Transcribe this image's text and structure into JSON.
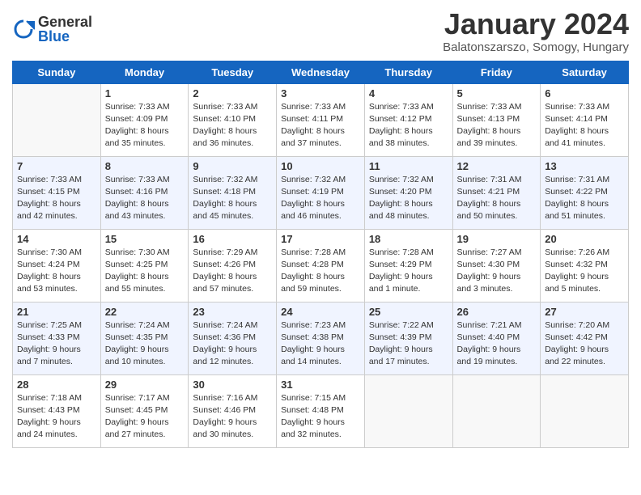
{
  "logo": {
    "general": "General",
    "blue": "Blue"
  },
  "title": "January 2024",
  "subtitle": "Balatonszarszo, Somogy, Hungary",
  "headers": [
    "Sunday",
    "Monday",
    "Tuesday",
    "Wednesday",
    "Thursday",
    "Friday",
    "Saturday"
  ],
  "weeks": [
    [
      {
        "num": "",
        "info": "",
        "shade": false,
        "empty": true
      },
      {
        "num": "1",
        "info": "Sunrise: 7:33 AM\nSunset: 4:09 PM\nDaylight: 8 hours\nand 35 minutes.",
        "shade": false,
        "empty": false
      },
      {
        "num": "2",
        "info": "Sunrise: 7:33 AM\nSunset: 4:10 PM\nDaylight: 8 hours\nand 36 minutes.",
        "shade": false,
        "empty": false
      },
      {
        "num": "3",
        "info": "Sunrise: 7:33 AM\nSunset: 4:11 PM\nDaylight: 8 hours\nand 37 minutes.",
        "shade": false,
        "empty": false
      },
      {
        "num": "4",
        "info": "Sunrise: 7:33 AM\nSunset: 4:12 PM\nDaylight: 8 hours\nand 38 minutes.",
        "shade": false,
        "empty": false
      },
      {
        "num": "5",
        "info": "Sunrise: 7:33 AM\nSunset: 4:13 PM\nDaylight: 8 hours\nand 39 minutes.",
        "shade": false,
        "empty": false
      },
      {
        "num": "6",
        "info": "Sunrise: 7:33 AM\nSunset: 4:14 PM\nDaylight: 8 hours\nand 41 minutes.",
        "shade": false,
        "empty": false
      }
    ],
    [
      {
        "num": "7",
        "info": "Sunrise: 7:33 AM\nSunset: 4:15 PM\nDaylight: 8 hours\nand 42 minutes.",
        "shade": true,
        "empty": false
      },
      {
        "num": "8",
        "info": "Sunrise: 7:33 AM\nSunset: 4:16 PM\nDaylight: 8 hours\nand 43 minutes.",
        "shade": true,
        "empty": false
      },
      {
        "num": "9",
        "info": "Sunrise: 7:32 AM\nSunset: 4:18 PM\nDaylight: 8 hours\nand 45 minutes.",
        "shade": true,
        "empty": false
      },
      {
        "num": "10",
        "info": "Sunrise: 7:32 AM\nSunset: 4:19 PM\nDaylight: 8 hours\nand 46 minutes.",
        "shade": true,
        "empty": false
      },
      {
        "num": "11",
        "info": "Sunrise: 7:32 AM\nSunset: 4:20 PM\nDaylight: 8 hours\nand 48 minutes.",
        "shade": true,
        "empty": false
      },
      {
        "num": "12",
        "info": "Sunrise: 7:31 AM\nSunset: 4:21 PM\nDaylight: 8 hours\nand 50 minutes.",
        "shade": true,
        "empty": false
      },
      {
        "num": "13",
        "info": "Sunrise: 7:31 AM\nSunset: 4:22 PM\nDaylight: 8 hours\nand 51 minutes.",
        "shade": true,
        "empty": false
      }
    ],
    [
      {
        "num": "14",
        "info": "Sunrise: 7:30 AM\nSunset: 4:24 PM\nDaylight: 8 hours\nand 53 minutes.",
        "shade": false,
        "empty": false
      },
      {
        "num": "15",
        "info": "Sunrise: 7:30 AM\nSunset: 4:25 PM\nDaylight: 8 hours\nand 55 minutes.",
        "shade": false,
        "empty": false
      },
      {
        "num": "16",
        "info": "Sunrise: 7:29 AM\nSunset: 4:26 PM\nDaylight: 8 hours\nand 57 minutes.",
        "shade": false,
        "empty": false
      },
      {
        "num": "17",
        "info": "Sunrise: 7:28 AM\nSunset: 4:28 PM\nDaylight: 8 hours\nand 59 minutes.",
        "shade": false,
        "empty": false
      },
      {
        "num": "18",
        "info": "Sunrise: 7:28 AM\nSunset: 4:29 PM\nDaylight: 9 hours\nand 1 minute.",
        "shade": false,
        "empty": false
      },
      {
        "num": "19",
        "info": "Sunrise: 7:27 AM\nSunset: 4:30 PM\nDaylight: 9 hours\nand 3 minutes.",
        "shade": false,
        "empty": false
      },
      {
        "num": "20",
        "info": "Sunrise: 7:26 AM\nSunset: 4:32 PM\nDaylight: 9 hours\nand 5 minutes.",
        "shade": false,
        "empty": false
      }
    ],
    [
      {
        "num": "21",
        "info": "Sunrise: 7:25 AM\nSunset: 4:33 PM\nDaylight: 9 hours\nand 7 minutes.",
        "shade": true,
        "empty": false
      },
      {
        "num": "22",
        "info": "Sunrise: 7:24 AM\nSunset: 4:35 PM\nDaylight: 9 hours\nand 10 minutes.",
        "shade": true,
        "empty": false
      },
      {
        "num": "23",
        "info": "Sunrise: 7:24 AM\nSunset: 4:36 PM\nDaylight: 9 hours\nand 12 minutes.",
        "shade": true,
        "empty": false
      },
      {
        "num": "24",
        "info": "Sunrise: 7:23 AM\nSunset: 4:38 PM\nDaylight: 9 hours\nand 14 minutes.",
        "shade": true,
        "empty": false
      },
      {
        "num": "25",
        "info": "Sunrise: 7:22 AM\nSunset: 4:39 PM\nDaylight: 9 hours\nand 17 minutes.",
        "shade": true,
        "empty": false
      },
      {
        "num": "26",
        "info": "Sunrise: 7:21 AM\nSunset: 4:40 PM\nDaylight: 9 hours\nand 19 minutes.",
        "shade": true,
        "empty": false
      },
      {
        "num": "27",
        "info": "Sunrise: 7:20 AM\nSunset: 4:42 PM\nDaylight: 9 hours\nand 22 minutes.",
        "shade": true,
        "empty": false
      }
    ],
    [
      {
        "num": "28",
        "info": "Sunrise: 7:18 AM\nSunset: 4:43 PM\nDaylight: 9 hours\nand 24 minutes.",
        "shade": false,
        "empty": false
      },
      {
        "num": "29",
        "info": "Sunrise: 7:17 AM\nSunset: 4:45 PM\nDaylight: 9 hours\nand 27 minutes.",
        "shade": false,
        "empty": false
      },
      {
        "num": "30",
        "info": "Sunrise: 7:16 AM\nSunset: 4:46 PM\nDaylight: 9 hours\nand 30 minutes.",
        "shade": false,
        "empty": false
      },
      {
        "num": "31",
        "info": "Sunrise: 7:15 AM\nSunset: 4:48 PM\nDaylight: 9 hours\nand 32 minutes.",
        "shade": false,
        "empty": false
      },
      {
        "num": "",
        "info": "",
        "shade": false,
        "empty": true
      },
      {
        "num": "",
        "info": "",
        "shade": false,
        "empty": true
      },
      {
        "num": "",
        "info": "",
        "shade": false,
        "empty": true
      }
    ]
  ]
}
